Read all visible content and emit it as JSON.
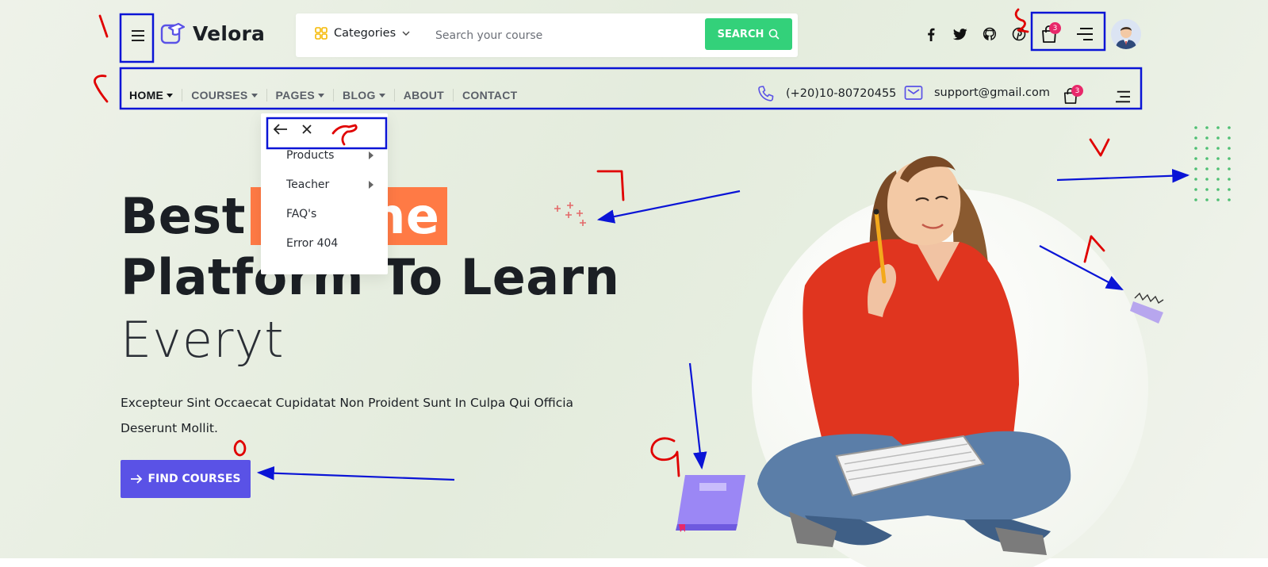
{
  "brand": {
    "name": "Velora"
  },
  "search": {
    "category_label": "Categories",
    "placeholder": "Search your course",
    "button_label": "SEARCH"
  },
  "header": {
    "social_icons": [
      "facebook-icon",
      "twitter-icon",
      "github-icon",
      "pinterest-icon"
    ],
    "cart_count": "3"
  },
  "nav": {
    "items": [
      {
        "label": "HOME",
        "has_caret": true
      },
      {
        "label": "COURSES",
        "has_caret": true
      },
      {
        "label": "PAGES",
        "has_caret": true
      },
      {
        "label": "BLOG",
        "has_caret": true
      },
      {
        "label": "ABOUT",
        "has_caret": false
      },
      {
        "label": "CONTACT",
        "has_caret": false
      }
    ],
    "phone": "(+20)10-80720455",
    "email": "support@gmail.com",
    "cart_count": "3"
  },
  "pages_dropdown": {
    "items": [
      {
        "label": "Products",
        "has_submenu": true
      },
      {
        "label": "Teacher",
        "has_submenu": true
      },
      {
        "label": "FAQ's",
        "has_submenu": false
      },
      {
        "label": "Error 404",
        "has_submenu": false
      }
    ]
  },
  "hero": {
    "title_line1": "Best",
    "title_highlight": "Online",
    "title_line2": "Platform To Learn",
    "title_line3": "Everyt",
    "description": "Excepteur Sint Occaecat Cupidatat Non Proident Sunt In Culpa Qui Officia Deserunt Mollit.",
    "button_label": "FIND COURSES"
  },
  "colors": {
    "accent_green": "#33d17a",
    "accent_purple": "#5a52e6",
    "highlight_orange": "#ff7a45",
    "badge_pink": "#e8286a",
    "annotation_blue": "#0a14d6",
    "annotation_red": "#e00000"
  }
}
